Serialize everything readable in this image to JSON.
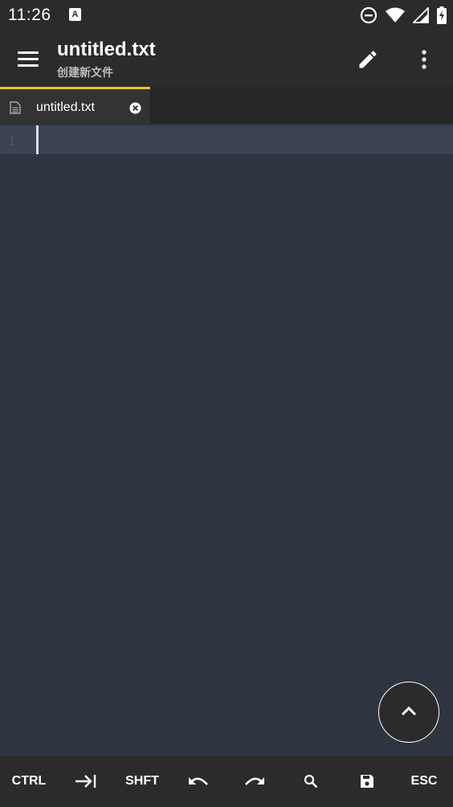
{
  "status_bar": {
    "time": "11:26",
    "notification_icon": "a-icon",
    "icons": [
      "dnd-icon",
      "wifi-icon",
      "signal-icon",
      "battery-charging-icon"
    ]
  },
  "app_bar": {
    "title": "untitled.txt",
    "subtitle": "创建新文件",
    "menu_icon": "hamburger-menu-icon",
    "edit_icon": "pencil-icon",
    "more_icon": "more-vertical-icon"
  },
  "tabs": [
    {
      "label": "untitled.txt",
      "icon": "file-icon",
      "close_icon": "close-circle-icon",
      "active": true
    }
  ],
  "editor": {
    "line_numbers": [
      "1"
    ],
    "content": ""
  },
  "fab": {
    "icon": "chevron-up-icon"
  },
  "bottom_toolbar": {
    "ctrl": "CTRL",
    "tab_icon": "tab-arrow-icon",
    "shift": "SHFT",
    "undo_icon": "undo-icon",
    "redo_icon": "redo-icon",
    "search_icon": "search-icon",
    "save_icon": "save-icon",
    "esc": "ESC"
  },
  "colors": {
    "tab_accent": "#e8c126",
    "editor_bg": "#2e3440",
    "current_line_bg": "#3b4252",
    "bar_bg": "#2b2b2b"
  }
}
